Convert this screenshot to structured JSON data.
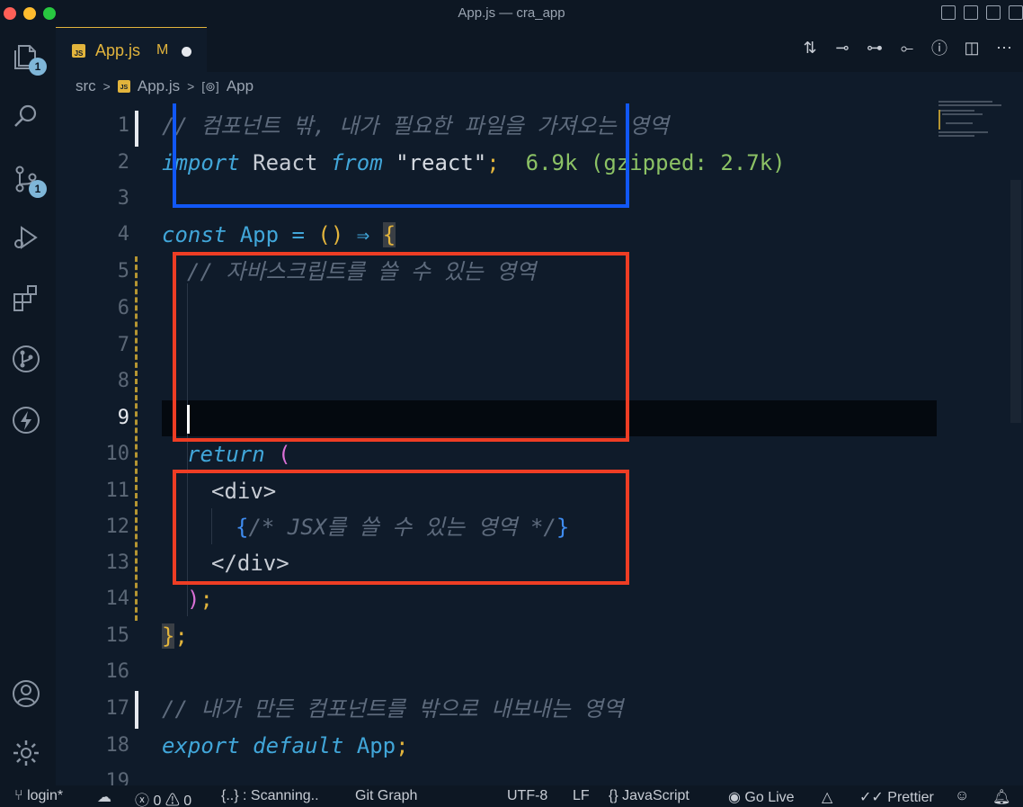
{
  "window": {
    "title": "App.js — cra_app"
  },
  "activity_bar": {
    "explorer_badge": "1",
    "scm_badge": "1",
    "icons": [
      "files-icon",
      "search-icon",
      "source-control-icon",
      "run-debug-icon",
      "extensions-icon",
      "git-graph-icon",
      "lightning-icon",
      "account-icon",
      "settings-gear-icon"
    ]
  },
  "tab": {
    "label": "App.js",
    "status": "M",
    "language_badge": "JS"
  },
  "breadcrumb": {
    "folder": "src",
    "file": "App.js",
    "symbol": "App"
  },
  "editor": {
    "active_line": "9",
    "lines": [
      {
        "n": "1",
        "c1": "// 컴포넌트 밖, 내가 필요한 파일을 가져오는 영역"
      },
      {
        "n": "2",
        "kw1": "import",
        "id1": "React",
        "kw2": "from",
        "str": "\"react\"",
        "punc": ";",
        "size": "6.9k (gzipped: 2.7k)"
      },
      {
        "n": "3"
      },
      {
        "n": "4",
        "kw": "const",
        "name": "App",
        "eq": "=",
        "parens": "()",
        "arrow": "⇒",
        "brace": "{"
      },
      {
        "n": "5",
        "comment": "// 자바스크립트를 쓸 수 있는 영역"
      },
      {
        "n": "6"
      },
      {
        "n": "7"
      },
      {
        "n": "8"
      },
      {
        "n": "9"
      },
      {
        "n": "10",
        "kw": "return",
        "paren": "("
      },
      {
        "n": "11",
        "tag": "<div>"
      },
      {
        "n": "12",
        "open": "{",
        "comment": "/* JSX를 쓸 수 있는 영역 */",
        "close": "}"
      },
      {
        "n": "13",
        "tag": "</div>"
      },
      {
        "n": "14",
        "paren": ")",
        "semi": ";"
      },
      {
        "n": "15",
        "brace": "}",
        "semi": ";"
      },
      {
        "n": "16"
      },
      {
        "n": "17",
        "comment": "// 내가 만든 컴포넌트를 밖으로 내보내는 영역"
      },
      {
        "n": "18",
        "kw": "export default",
        "name": "App",
        "semi": ";"
      },
      {
        "n": "19"
      }
    ]
  },
  "status_bar": {
    "branch": "login*",
    "errors": "0",
    "warnings": "0",
    "scanning": "{..} : Scanning..",
    "git_graph": "Git Graph",
    "encoding": "UTF-8",
    "eol": "LF",
    "language": "JavaScript",
    "go_live": "Go Live",
    "prettier": "Prettier"
  },
  "colors": {
    "highlight_blue": "#1157f5",
    "highlight_red": "#ee3d24",
    "tab_accent": "#e2b43c",
    "background": "#0f1b2a"
  }
}
